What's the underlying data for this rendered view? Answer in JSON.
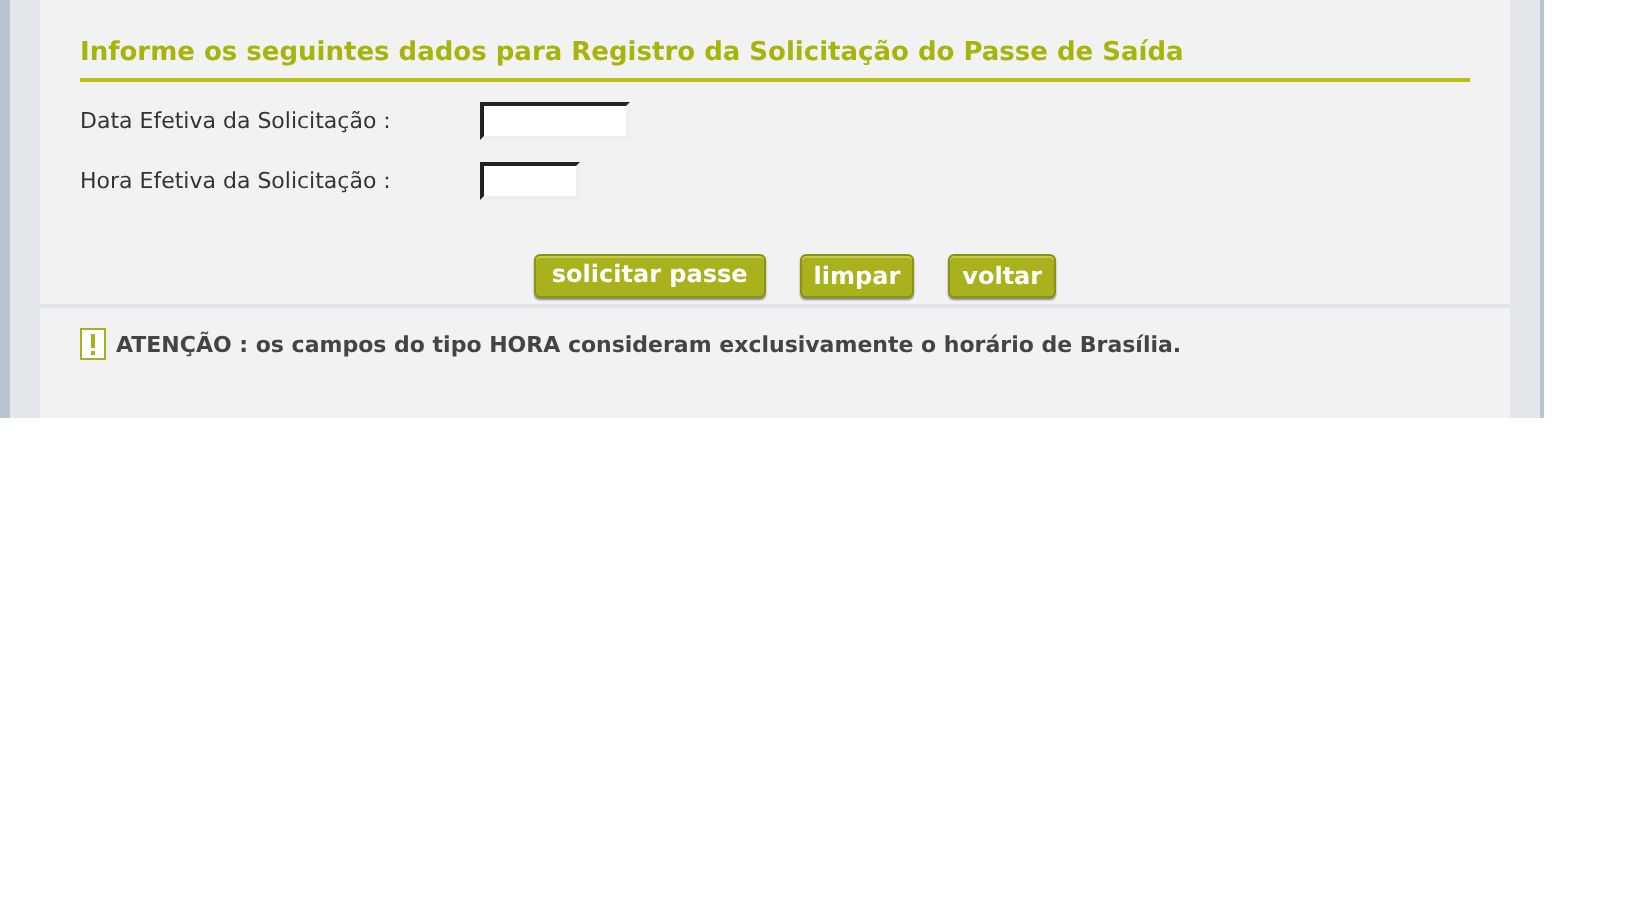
{
  "form": {
    "title": "Informe os seguintes dados para Registro da Solicitação do Passe de Saída",
    "fields": [
      {
        "label": "Data Efetiva da Solicitação :",
        "kind": "date"
      },
      {
        "label": "Hora Efetiva da Solicitação :",
        "kind": "time"
      }
    ],
    "buttons": [
      {
        "label": "solicitar passe",
        "kind": "primary"
      },
      {
        "label": "limpar",
        "kind": "secondary"
      },
      {
        "label": "voltar",
        "kind": "secondary"
      }
    ]
  },
  "notice": {
    "text": "ATENÇÃO : os campos do tipo HORA consideram exclusivamente o horário de Brasília."
  }
}
